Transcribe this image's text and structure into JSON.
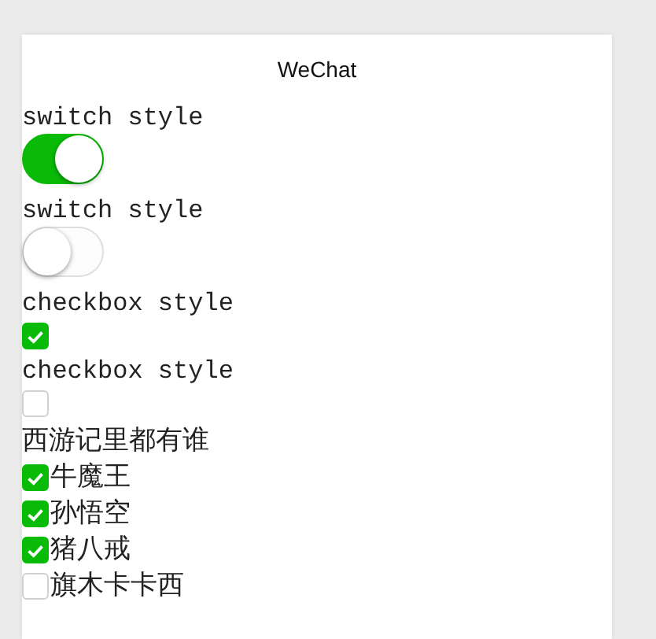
{
  "window": {
    "title": "WeChat"
  },
  "controls": [
    {
      "kind": "switch",
      "label": "switch style",
      "on": true
    },
    {
      "kind": "switch",
      "label": "switch style",
      "on": false
    },
    {
      "kind": "checkbox",
      "label": "checkbox style",
      "checked": true
    },
    {
      "kind": "checkbox",
      "label": "checkbox style",
      "checked": false
    }
  ],
  "checkbox_group": {
    "label": "西游记里都有谁",
    "options": [
      {
        "label": "牛魔王",
        "checked": true
      },
      {
        "label": "孙悟空",
        "checked": true
      },
      {
        "label": "猪八戒",
        "checked": true
      },
      {
        "label": "旗木卡卡西",
        "checked": false
      }
    ]
  }
}
